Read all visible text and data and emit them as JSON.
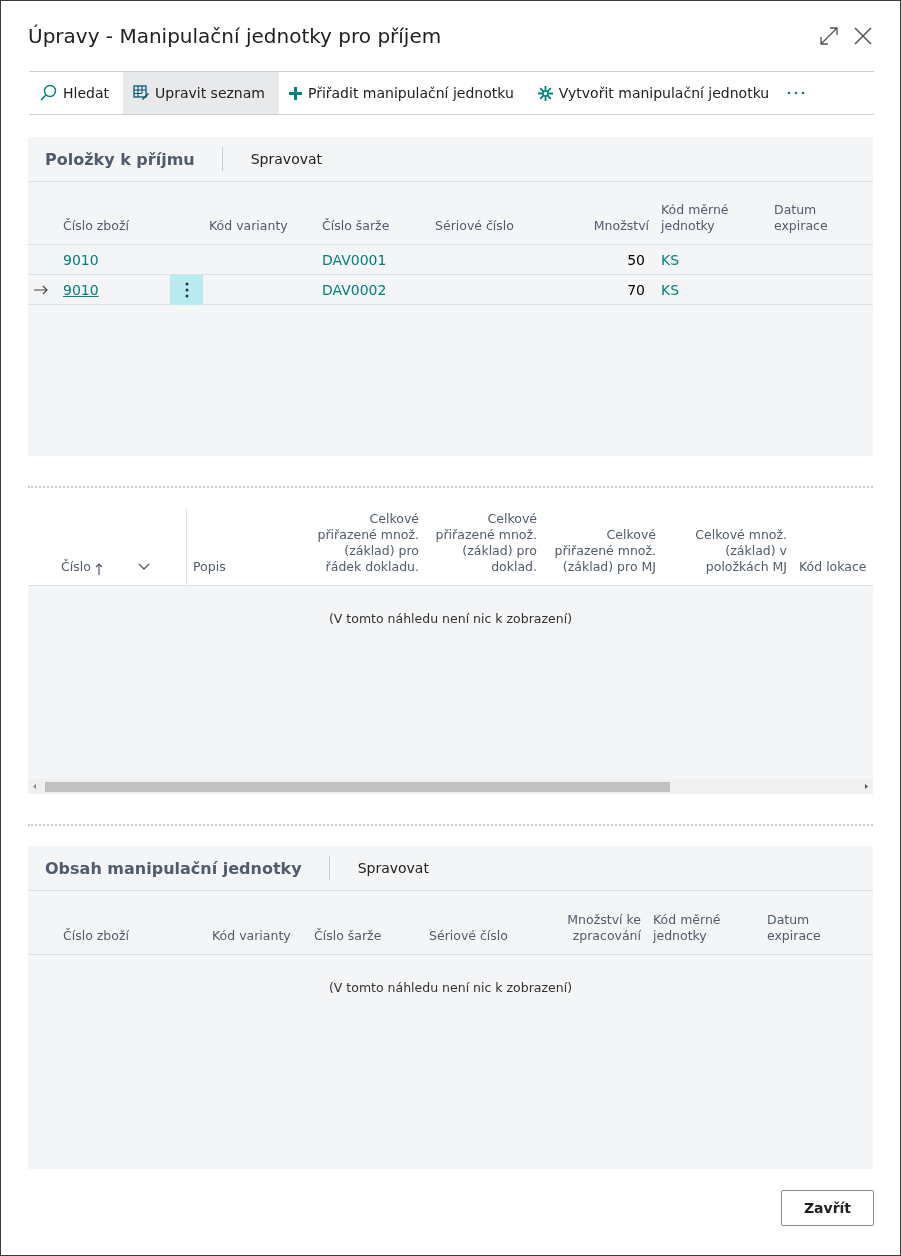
{
  "window": {
    "title": "Úpravy - Manipulační jednotky pro příjem"
  },
  "toolbar": [
    {
      "kind": "search",
      "label": "Hledat",
      "selected": false
    },
    {
      "kind": "edit-list",
      "label": "Upravit seznam",
      "selected": true
    },
    {
      "kind": "plus",
      "label": "Přiřadit manipulační jednotku",
      "selected": false
    },
    {
      "kind": "asterisk",
      "label": "Vytvořit manipulační jednotku",
      "selected": false
    }
  ],
  "receipt_lines": {
    "title": "Položky k příjmu",
    "action": "Spravovat",
    "columns": [
      {
        "label": "Číslo zboží"
      },
      {
        "label": "Kód varianty"
      },
      {
        "label": "Číslo šarže"
      },
      {
        "label": "Sériové číslo"
      },
      {
        "label": "Množství"
      },
      {
        "label": "Kód měrné jednotky"
      },
      {
        "label": "Datum expirace"
      }
    ],
    "rows": [
      {
        "item_no": "9010",
        "lot_no": "DAV0001",
        "quantity": "50",
        "uom": "KS",
        "current": false
      },
      {
        "item_no": "9010",
        "lot_no": "DAV0002",
        "quantity": "70",
        "uom": "KS",
        "current": true
      }
    ]
  },
  "handling_units": {
    "columns": [
      {
        "label": "Číslo",
        "sorted_ascending": true
      },
      {
        "label": "Popis"
      },
      {
        "label": "Celkové přiřazené množ. (základ) pro řádek dokladu."
      },
      {
        "label": "Celkové přiřazené množ. (základ) pro doklad."
      },
      {
        "label": "Celkové přiřazené množ. (základ) pro MJ"
      },
      {
        "label": "Celkové množ. (základ) v položkách MJ"
      },
      {
        "label": "Kód lokace"
      }
    ],
    "empty_message": "(V tomto náhledu není nic k zobrazení)"
  },
  "unit_contents": {
    "title": "Obsah manipulační jednotky",
    "action": "Spravovat",
    "columns": [
      {
        "label": "Číslo zboží"
      },
      {
        "label": "Kód varianty"
      },
      {
        "label": "Číslo šarže"
      },
      {
        "label": "Sériové číslo"
      },
      {
        "label": "Množství ke zpracování"
      },
      {
        "label": "Kód měrné jednotky"
      },
      {
        "label": "Datum expirace"
      }
    ],
    "empty_message": "(V tomto náhledu není nic k zobrazení)"
  },
  "footer": {
    "close_button": "Zavřít"
  }
}
